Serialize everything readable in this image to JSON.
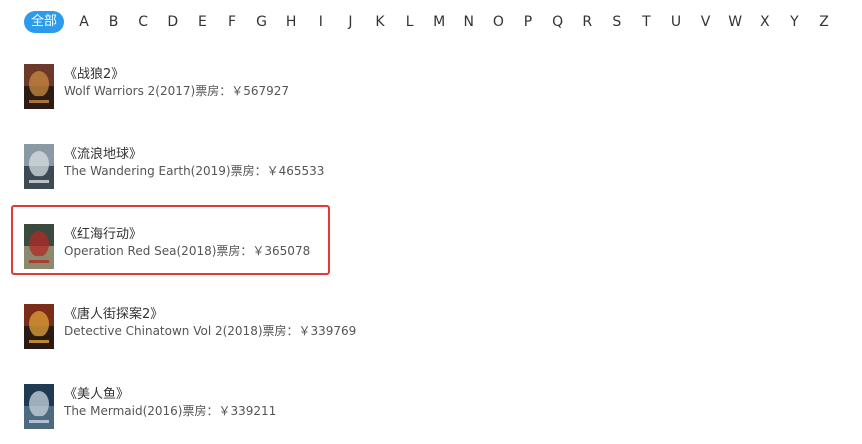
{
  "filter": {
    "all_label": "全部",
    "letters": [
      "A",
      "B",
      "C",
      "D",
      "E",
      "F",
      "G",
      "H",
      "I",
      "J",
      "K",
      "L",
      "M",
      "N",
      "O",
      "P",
      "Q",
      "R",
      "S",
      "T",
      "U",
      "V",
      "W",
      "X",
      "Y",
      "Z"
    ]
  },
  "movies": [
    {
      "title": "《战狼2》",
      "meta": "Wolf Warriors 2(2017)票房：￥567927",
      "poster_colors": [
        "#6b3a2a",
        "#c9893f",
        "#2b1c16"
      ]
    },
    {
      "title": "《流浪地球》",
      "meta": "The Wandering Earth(2019)票房：￥465533",
      "poster_colors": [
        "#8a9aa5",
        "#d6dde2",
        "#3d4a55"
      ]
    },
    {
      "title": "《红海行动》",
      "meta": "Operation Red Sea(2018)票房：￥365078",
      "poster_colors": [
        "#3a4a3e",
        "#b22a24",
        "#8c8a6e"
      ]
    },
    {
      "title": "《唐人街探案2》",
      "meta": "Detective Chinatown Vol 2(2018)票房：￥339769",
      "poster_colors": [
        "#7a2e1a",
        "#e0a23a",
        "#2c1a14"
      ]
    },
    {
      "title": "《美人鱼》",
      "meta": "The Mermaid(2016)票房：￥339211",
      "poster_colors": [
        "#1f3a52",
        "#c9d6de",
        "#4c6a80"
      ]
    }
  ],
  "colors": {
    "accent": "#2e9bea",
    "highlight": "#e53935"
  }
}
